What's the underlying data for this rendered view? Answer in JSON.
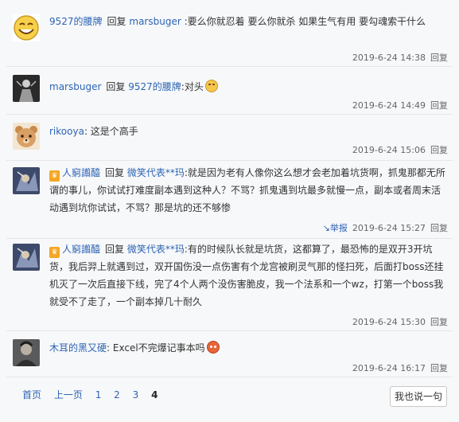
{
  "comments": [
    {
      "username": "9527的腰牌",
      "avatar": "smiley-face-avatar",
      "reply_word": "回复",
      "reply_to": "marsbuger",
      "text": ":要么你就忍着 要么你就杀 如果生气有用 要勾魂索干什么",
      "time": "2019-6-24 14:38",
      "reply_label": "回复"
    },
    {
      "username": "marsbuger",
      "avatar": "dark-figure-avatar",
      "reply_word": "回复",
      "reply_to": "9527的腰牌",
      "text": ":对头",
      "emoji": "smile-emoji",
      "time": "2019-6-24 14:49",
      "reply_label": "回复"
    },
    {
      "username": "rikooya",
      "avatar": "bear-avatar",
      "text": ": 这是个高手",
      "time": "2019-6-24 15:06",
      "reply_label": "回复"
    },
    {
      "username": "人窮譾醯",
      "avatar": "game-character-avatar",
      "badge": "vip-badge",
      "reply_word": "回复",
      "reply_to": "微笑代表**玛",
      "text": ":就是因为老有人像你这么想才会老加着坑货啊，抓鬼那都无所谓的事儿，你试试打难度副本遇到这种人？不骂？抓鬼遇到坑最多就慢一点，副本或者周末活动遇到坑你试试，不骂？那是坑的还不够惨",
      "report_label": "举报",
      "time": "2019-6-24 15:27",
      "reply_label": "回复"
    },
    {
      "username": "人窮譾醯",
      "avatar": "game-character-avatar",
      "badge": "vip-badge",
      "reply_word": "回复",
      "reply_to": "微笑代表**玛",
      "text": ":有的时候队长就是坑货，这都算了，最恐怖的是双开3开坑货，我后羿上就遇到过，双开国伤没一点伤害有个龙宫被刷灵气那的怪扫死，后面打boss还挂机灭了一次后直接下线，完了4个人两个没伤害脆皮，我一个法系和一个wz，打第一个boss我就受不了走了，一个副本掉几十耐久",
      "time": "2019-6-24 15:30",
      "reply_label": "回复"
    },
    {
      "username": "木耳的黑又硬",
      "avatar": "photo-avatar",
      "text": ": Excel不完爆记事本吗",
      "emoji": "angry-emoji",
      "time": "2019-6-24 16:17",
      "reply_label": "回复"
    }
  ],
  "pager": {
    "first": "首页",
    "prev": "上一页",
    "pages": [
      "1",
      "2",
      "3",
      "4"
    ],
    "current": "4"
  },
  "reply_button": "我也说一句"
}
